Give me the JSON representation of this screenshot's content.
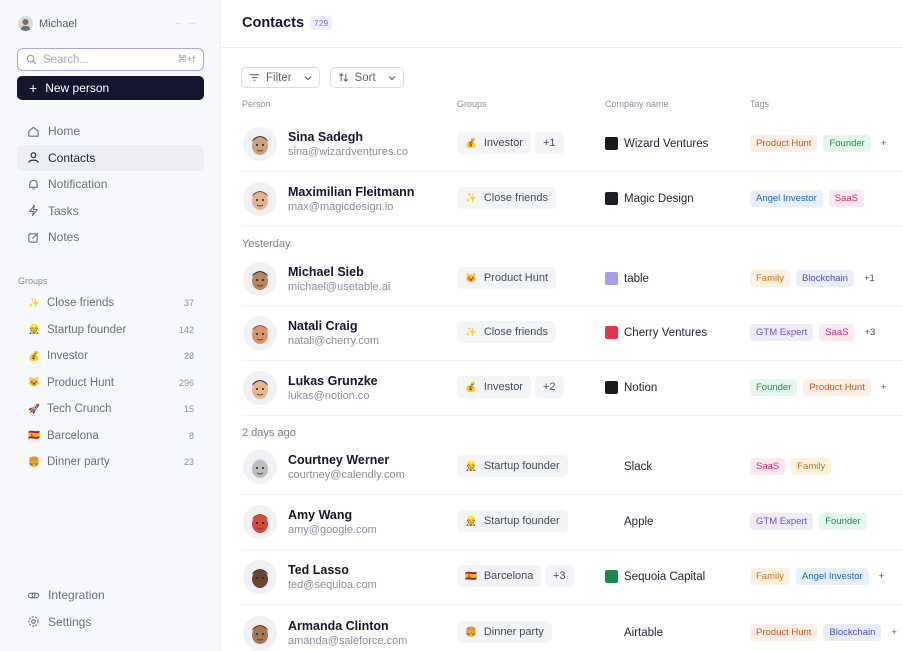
{
  "sidebar": {
    "user_name": "Michael",
    "search_placeholder": "Search...",
    "search_shortcut": "⌘+f",
    "new_person_label": "New person",
    "nav": [
      {
        "label": "Home",
        "icon": "home-icon"
      },
      {
        "label": "Contacts",
        "icon": "person-icon",
        "active": true
      },
      {
        "label": "Notification",
        "icon": "bell-icon"
      },
      {
        "label": "Tasks",
        "icon": "bolt-icon"
      },
      {
        "label": "Notes",
        "icon": "edit-icon"
      }
    ],
    "groups_title": "Groups",
    "groups": [
      {
        "emoji": "✨",
        "label": "Close friends",
        "count": "37"
      },
      {
        "emoji": "👷",
        "label": "Startup founder",
        "count": "142"
      },
      {
        "emoji": "💰",
        "label": "Investor",
        "count": "28"
      },
      {
        "emoji": "😺",
        "label": "Product Hunt",
        "count": "296"
      },
      {
        "emoji": "🚀",
        "label": "Tech Crunch",
        "count": "15"
      },
      {
        "emoji": "🇪🇸",
        "label": "Barcelona",
        "count": "8"
      },
      {
        "emoji": "🍔",
        "label": "Dinner party",
        "count": "23"
      }
    ],
    "bottom": [
      {
        "label": "Integration",
        "icon": "link-icon"
      },
      {
        "label": "Settings",
        "icon": "gear-icon"
      }
    ]
  },
  "main": {
    "title": "Contacts",
    "count": "729",
    "filter_label": "Filter",
    "sort_label": "Sort",
    "columns": {
      "person": "Person",
      "groups": "Groups",
      "company": "Company name",
      "tags": "Tags"
    },
    "sections": [
      "Yesterday",
      "2 days ago"
    ],
    "rows": [
      {
        "name": "Sina Sadegh",
        "email": "sina@wizardventures.co",
        "group_emoji": "💰",
        "group": "Investor",
        "more": "+1",
        "company": "Wizard Ventures",
        "company_logo_color": "#1a1a1a",
        "tags": [
          {
            "t": "Product Hunt",
            "c": "#d1541c",
            "bg": "#fdeee6"
          },
          {
            "t": "Founder",
            "c": "#1f8a55",
            "bg": "#e5f6ec"
          }
        ],
        "tags_more": "+"
      },
      {
        "name": "Maximilian Fleitmann",
        "email": "max@magicdesign.io",
        "group_emoji": "✨",
        "group": "Close friends",
        "more": "",
        "company": "Magic Design",
        "company_logo_color": "#1c1c2b",
        "tags": [
          {
            "t": "Angel Investor",
            "c": "#2366c4",
            "bg": "#e7f0fc"
          },
          {
            "t": "SaaS",
            "c": "#d02a7a",
            "bg": "#fce8f2"
          }
        ],
        "tags_more": ""
      },
      {
        "name": "Michael Sieb",
        "email": "michael@usetable.ai",
        "group_emoji": "😺",
        "group": "Product Hunt",
        "more": "",
        "company": "table",
        "company_logo_color": "#a99cf0",
        "tags": [
          {
            "t": "Family",
            "c": "#c8771c",
            "bg": "#fdf1e2"
          },
          {
            "t": "Blockchain",
            "c": "#4b4fc8",
            "bg": "#ecedfb"
          }
        ],
        "tags_more": "+1"
      },
      {
        "name": "Natali Craig",
        "email": "natali@cherry.com",
        "group_emoji": "✨",
        "group": "Close friends",
        "more": "",
        "company": "Cherry Ventures",
        "company_logo_color": "#e8344c",
        "tags": [
          {
            "t": "GTM Expert",
            "c": "#6f55c9",
            "bg": "#efebfb"
          },
          {
            "t": "SaaS",
            "c": "#d02a7a",
            "bg": "#fce8f2"
          }
        ],
        "tags_more": "+3"
      },
      {
        "name": "Lukas Grunzke",
        "email": "lukas@notion.co",
        "group_emoji": "💰",
        "group": "Investor",
        "more": "+2",
        "company": "Notion",
        "company_logo_color": "#1a1a1a",
        "tags": [
          {
            "t": "Founder",
            "c": "#1f8a55",
            "bg": "#e5f6ec"
          },
          {
            "t": "Product Hunt",
            "c": "#d1541c",
            "bg": "#fdeee6"
          }
        ],
        "tags_more": "+"
      },
      {
        "name": "Courtney Werner",
        "email": "courtney@calendly.com",
        "group_emoji": "👷",
        "group": "Startup founder",
        "more": "",
        "company": "Slack",
        "company_logo_color": "#ffffff",
        "tags": [
          {
            "t": "SaaS",
            "c": "#d02a7a",
            "bg": "#fce8f2"
          },
          {
            "t": "Family",
            "c": "#c8771c",
            "bg": "#fdf1e2"
          }
        ],
        "tags_more": ""
      },
      {
        "name": "Amy Wang",
        "email": "amy@google.com",
        "group_emoji": "👷",
        "group": "Startup founder",
        "more": "",
        "company": "Apple",
        "company_logo_color": "#ffffff",
        "tags": [
          {
            "t": "GTM Expert",
            "c": "#6f55c9",
            "bg": "#efebfb"
          },
          {
            "t": "Founder",
            "c": "#1f8a55",
            "bg": "#e5f6ec"
          }
        ],
        "tags_more": ""
      },
      {
        "name": "Ted Lasso",
        "email": "ted@sequioa.com",
        "group_emoji": "🇪🇸",
        "group": "Barcelona",
        "more": "+3",
        "company": "Sequoia Capital",
        "company_logo_color": "#1a8a4a",
        "tags": [
          {
            "t": "Family",
            "c": "#c8771c",
            "bg": "#fdf1e2"
          },
          {
            "t": "Angel Investor",
            "c": "#2366c4",
            "bg": "#e7f0fc"
          }
        ],
        "tags_more": "+"
      },
      {
        "name": "Armanda Clinton",
        "email": "amanda@saleforce.com",
        "group_emoji": "🍔",
        "group": "Dinner party",
        "more": "",
        "company": "Airtable",
        "company_logo_color": "#ffffff",
        "tags": [
          {
            "t": "Product Hunt",
            "c": "#d1541c",
            "bg": "#fdeee6"
          },
          {
            "t": "Blockchain",
            "c": "#4b4fc8",
            "bg": "#ecedfb"
          }
        ],
        "tags_more": "+"
      }
    ]
  }
}
